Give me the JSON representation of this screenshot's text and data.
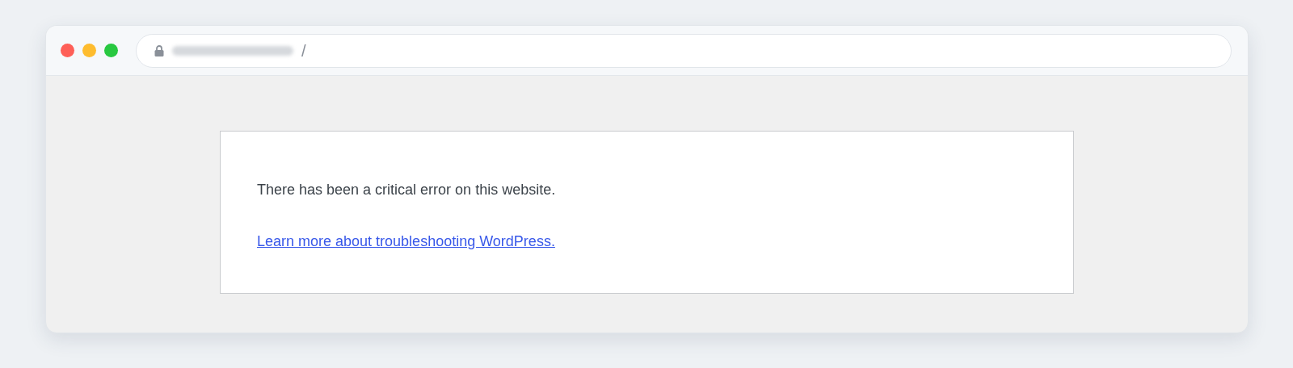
{
  "address_bar": {
    "path": "/"
  },
  "error_box": {
    "message": "There has been a critical error on this website.",
    "link": "Learn more about troubleshooting WordPress."
  }
}
